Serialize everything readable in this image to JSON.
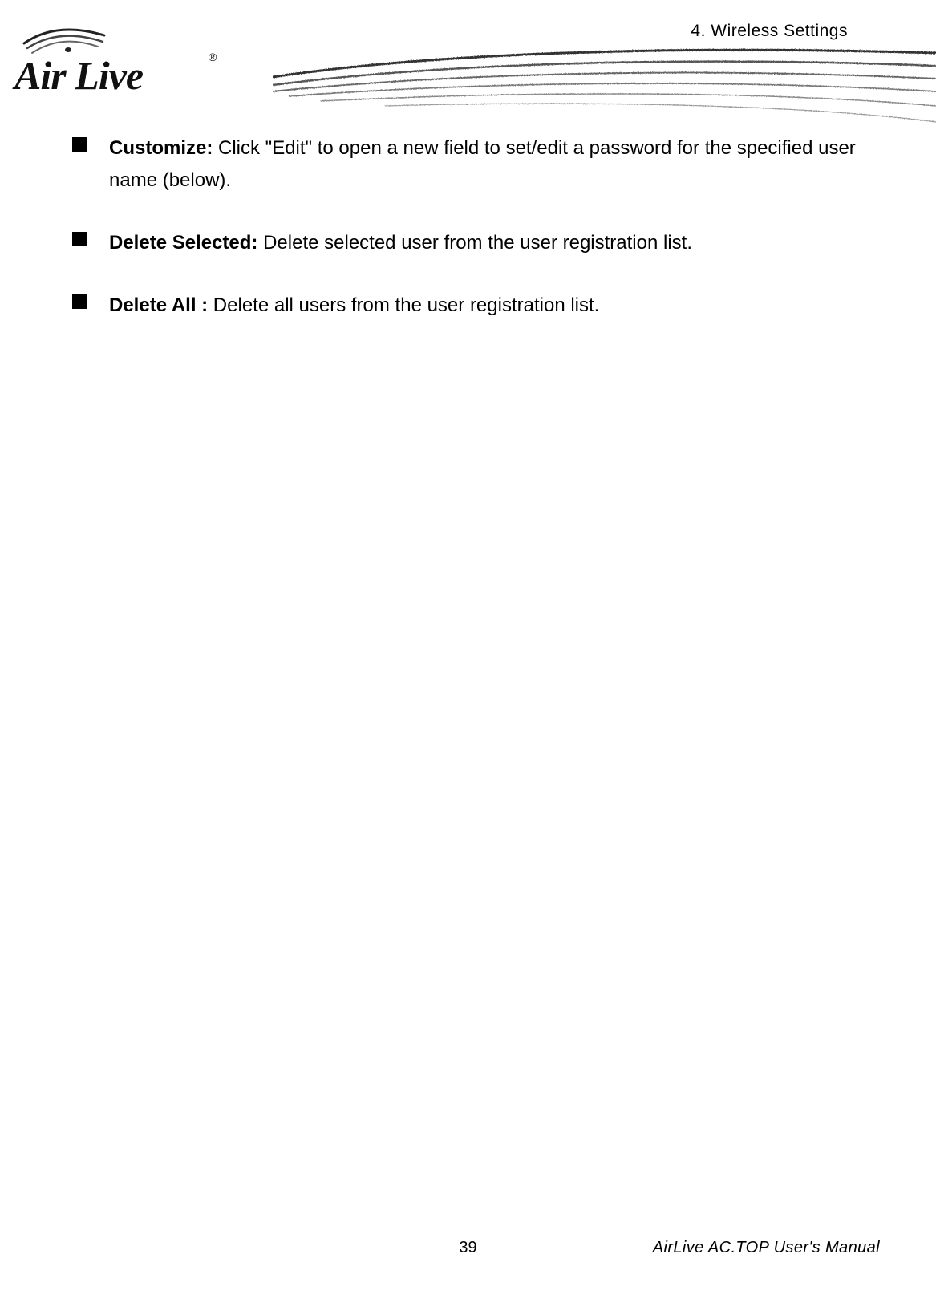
{
  "header": {
    "section_title": "4. Wireless Settings",
    "logo_text": "Air Live",
    "logo_trademark": "®"
  },
  "items": [
    {
      "label": "Customize:",
      "desc": " Click \"Edit\" to open a new field to set/edit a password for the specified user name (below)."
    },
    {
      "label": "Delete Selected:",
      "desc": " Delete selected user from the user registration list."
    },
    {
      "label": "Delete All :",
      "desc": " Delete all users from the user registration list."
    }
  ],
  "footer": {
    "page_number": "39",
    "manual_title": "AirLive AC.TOP User's Manual"
  }
}
